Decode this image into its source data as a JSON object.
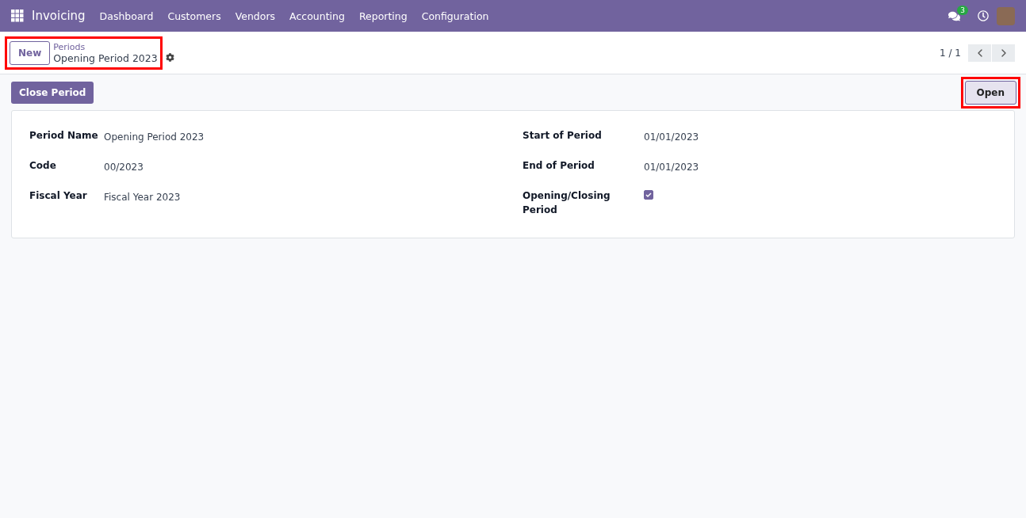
{
  "navbar": {
    "app": "Invoicing",
    "menu": [
      "Dashboard",
      "Customers",
      "Vendors",
      "Accounting",
      "Reporting",
      "Configuration"
    ],
    "chat_count": "3"
  },
  "control_panel": {
    "new_button": "New",
    "breadcrumb": "Periods",
    "record": "Opening Period 2023",
    "pager": "1 / 1"
  },
  "actions": {
    "buttons": [
      "Close Period"
    ],
    "status": [
      {
        "label": "Open",
        "selected": true
      }
    ]
  },
  "form": {
    "left": [
      {
        "kind": "text",
        "label": "Period Name",
        "value": "Opening Period 2023"
      },
      {
        "kind": "text",
        "label": "Code",
        "value": "00/2023"
      },
      {
        "kind": "text",
        "label": "Fiscal Year",
        "value": "Fiscal Year 2023"
      }
    ],
    "right": [
      {
        "kind": "text",
        "label": "Start of Period",
        "value": "01/01/2023"
      },
      {
        "kind": "text",
        "label": "End of Period",
        "value": "01/01/2023"
      },
      {
        "kind": "checkbox",
        "label": "Opening/Closing Period",
        "checked": true
      }
    ]
  }
}
